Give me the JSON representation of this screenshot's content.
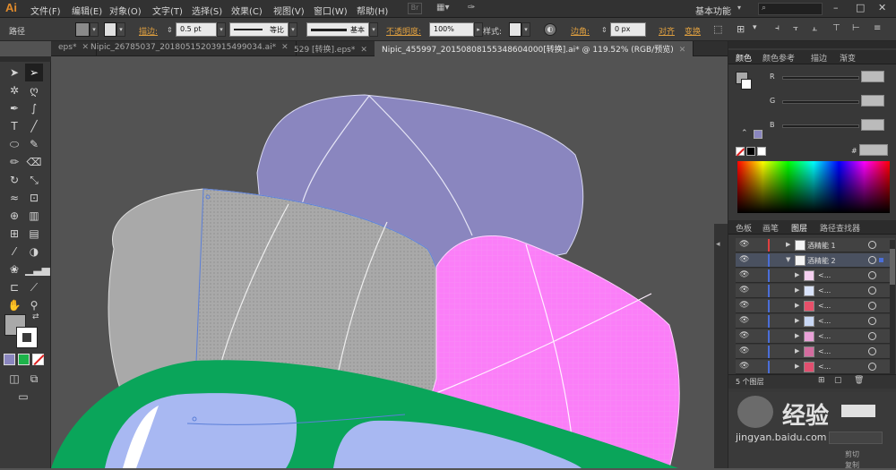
{
  "app": {
    "logo": "Ai",
    "workspace": "基本功能"
  },
  "menu": [
    "文件(F)",
    "编辑(E)",
    "对象(O)",
    "文字(T)",
    "选择(S)",
    "效果(C)",
    "视图(V)",
    "窗口(W)",
    "帮助(H)"
  ],
  "control": {
    "selection_label": "路径",
    "stroke_label": "描边:",
    "stroke_value": "0.5 pt",
    "profile_value": "等比",
    "brush_value": "基本",
    "opacity_label": "不透明度:",
    "opacity_value": "100%",
    "style_label": "样式:",
    "corner_label": "边角:",
    "corner_value": "0 px",
    "align_label": "对齐",
    "transform_label": "变换"
  },
  "tabs": [
    {
      "label": "eps*",
      "active": false
    },
    {
      "label": "Nipic_26785037_20180515203915499034.ai*",
      "active": false
    },
    {
      "label": "529 [转换].eps*",
      "active": false
    },
    {
      "label": "Nipic_455997_20150808155348604000[转换].ai* @ 119.52% (RGB/预览)",
      "active": true
    }
  ],
  "color_panel": {
    "tabs": [
      "颜色",
      "颜色参考",
      "描边",
      "渐变"
    ],
    "channels": [
      "R",
      "G",
      "B"
    ],
    "hex_label": "#"
  },
  "layers_panel": {
    "tabs": [
      "色板",
      "画笔",
      "图层",
      "路径查找器"
    ],
    "layers": [
      {
        "name": "酒精能 1",
        "expanded": false,
        "color": "#e04040"
      },
      {
        "name": "酒精能 2",
        "expanded": true,
        "color": "#4a6ed8"
      }
    ],
    "sublayers": [
      "<...",
      "<...",
      "<...",
      "<...",
      "<...",
      "<...",
      "<..."
    ],
    "count_label": "5 个图层"
  },
  "watermark": {
    "text": "经验",
    "site": "jingyan.baidu.com"
  },
  "overlay_labels": [
    "剪切",
    "复制"
  ],
  "colors": {
    "canvas_bg": "#535353",
    "purple_shape": "#8a86bf",
    "gray_shape": "#a9a9a9",
    "pink_shape": "#fb7ef8",
    "green_frame": "#0aa55a",
    "lens": "#a8b8f2",
    "accent": "#e08b2c"
  }
}
